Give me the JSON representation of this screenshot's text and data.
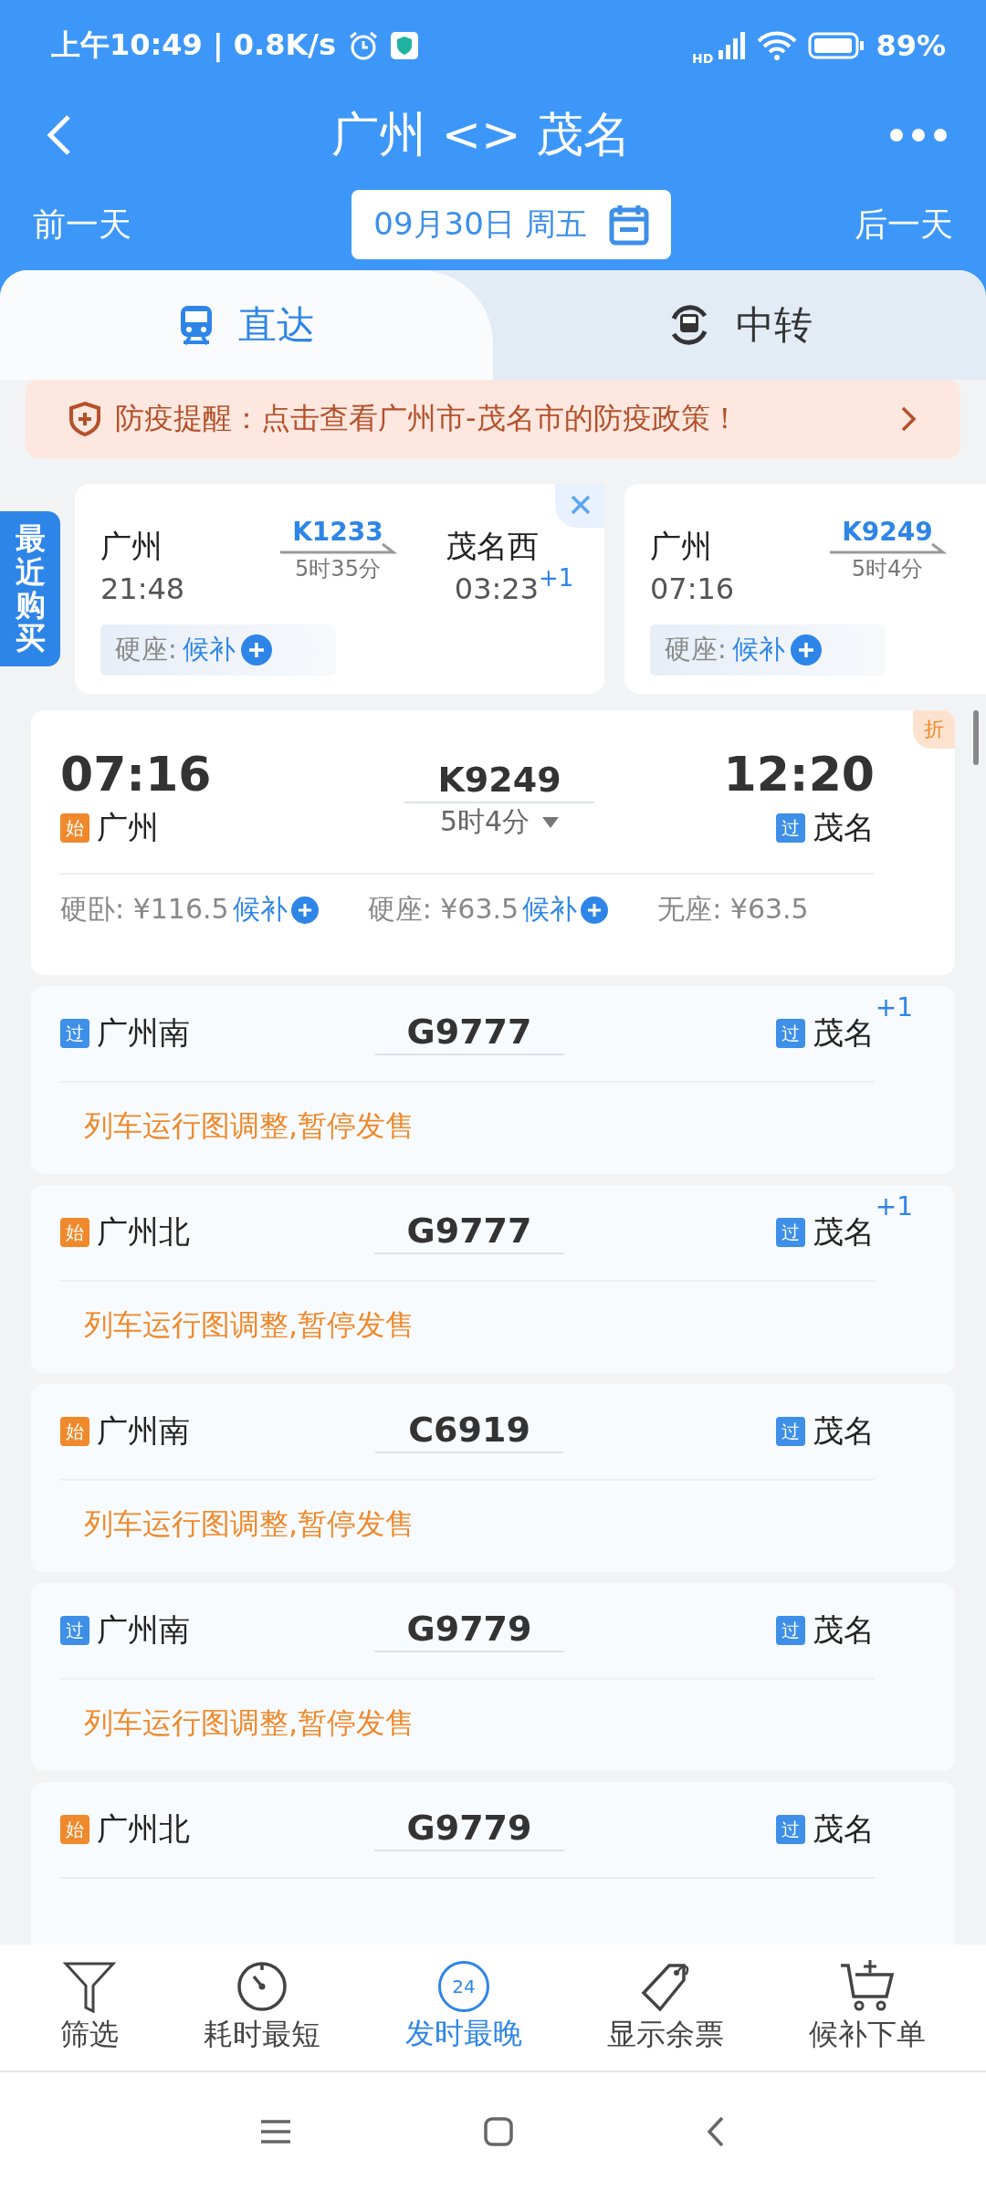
{
  "status_bar": {
    "time": "上午10:49 | 0.8K/s",
    "network": "HD",
    "battery": "89%"
  },
  "header": {
    "title": "广州 <> 茂名",
    "prev_day": "前一天",
    "date": "09月30日 周五",
    "next_day": "后一天"
  },
  "tabs": [
    {
      "label": "直达",
      "kind": "direct",
      "selected": true
    },
    {
      "label": "中转",
      "kind": "transfer",
      "selected": false
    }
  ],
  "notice": "防疫提醒：点击查看广州市-茂名市的防疫政策！",
  "recent": {
    "title": "最近购买",
    "items": [
      {
        "from": "广州",
        "dep": "21:48",
        "train": "K1233",
        "duration": "5时35分",
        "to": "茂名西",
        "arr": "03:23",
        "day_offset": "+1",
        "seat": "硬座:",
        "action": "候补",
        "closable": true
      },
      {
        "from": "广州",
        "dep": "07:16",
        "train": "K9249",
        "duration": "5时4分",
        "seat": "硬座:",
        "action": "候补"
      }
    ]
  },
  "trains": [
    {
      "kind": "detail",
      "dep_time": "07:16",
      "from_tag": {
        "text": "始",
        "kind": "origin"
      },
      "from": "广州",
      "train": "K9249",
      "duration": "5时4分",
      "arr_time": "12:20",
      "to_tag": {
        "text": "过",
        "kind": "pass"
      },
      "to": "茂名",
      "badge": "折",
      "prices": [
        {
          "label": "硬卧: ¥116.5",
          "action": "候补"
        },
        {
          "label": "硬座: ¥63.5",
          "action": "候补"
        },
        {
          "label": "无座: ¥63.5"
        }
      ]
    },
    {
      "kind": "suspended",
      "from_tag": {
        "text": "过",
        "kind": "pass"
      },
      "from": "广州南",
      "train": "G9777",
      "to_tag": {
        "text": "过",
        "kind": "pass"
      },
      "to": "茂名",
      "day_offset": "+1",
      "note": "列车运行图调整,暂停发售"
    },
    {
      "kind": "suspended",
      "from_tag": {
        "text": "始",
        "kind": "origin"
      },
      "from": "广州北",
      "train": "G9777",
      "to_tag": {
        "text": "过",
        "kind": "pass"
      },
      "to": "茂名",
      "day_offset": "+1",
      "note": "列车运行图调整,暂停发售"
    },
    {
      "kind": "suspended",
      "from_tag": {
        "text": "始",
        "kind": "origin"
      },
      "from": "广州南",
      "train": "C6919",
      "to_tag": {
        "text": "过",
        "kind": "pass"
      },
      "to": "茂名",
      "note": "列车运行图调整,暂停发售"
    },
    {
      "kind": "suspended",
      "from_tag": {
        "text": "过",
        "kind": "pass"
      },
      "from": "广州南",
      "train": "G9779",
      "to_tag": {
        "text": "过",
        "kind": "pass"
      },
      "to": "茂名",
      "note": "列车运行图调整,暂停发售"
    },
    {
      "kind": "suspended",
      "from_tag": {
        "text": "始",
        "kind": "origin"
      },
      "from": "广州北",
      "train": "G9779",
      "to_tag": {
        "text": "过",
        "kind": "pass"
      },
      "to": "茂名"
    }
  ],
  "toolbar": [
    {
      "label": "筛选",
      "kind": "filter",
      "selected": false
    },
    {
      "label": "耗时最短",
      "kind": "timer",
      "selected": false
    },
    {
      "label": "发时最晚",
      "kind": "clock",
      "selected": true,
      "icon_text": "24"
    },
    {
      "label": "显示余票",
      "kind": "tag",
      "selected": false
    },
    {
      "label": "候补下单",
      "kind": "cart",
      "selected": false
    }
  ]
}
